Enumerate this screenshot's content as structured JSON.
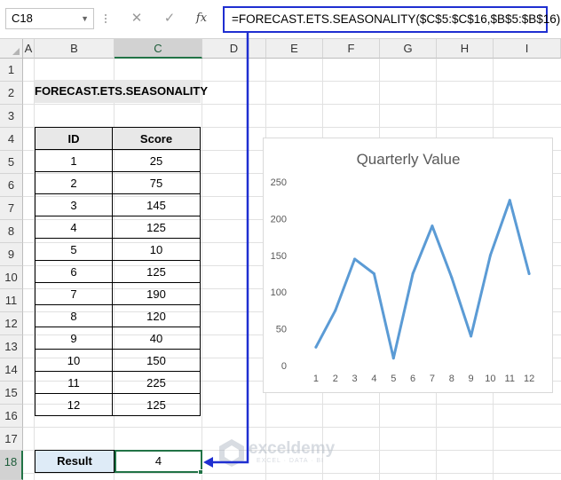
{
  "name_box": "C18",
  "formula_bar": {
    "cancel_icon": "✕",
    "enter_icon": "✓",
    "fx_label": "fx",
    "formula": "=FORECAST.ETS.SEASONALITY($C$5:$C$16,$B$5:$B$16)"
  },
  "columns": [
    "A",
    "B",
    "C",
    "D",
    "E",
    "F",
    "G",
    "H",
    "I"
  ],
  "rows": [
    "1",
    "2",
    "3",
    "4",
    "5",
    "6",
    "7",
    "8",
    "9",
    "10",
    "11",
    "12",
    "13",
    "14",
    "15",
    "16",
    "17",
    "18"
  ],
  "title_cell": "FORECAST.ETS.SEASONALITY",
  "table": {
    "headers": [
      "ID",
      "Score"
    ],
    "rows": [
      [
        "1",
        "25"
      ],
      [
        "2",
        "75"
      ],
      [
        "3",
        "145"
      ],
      [
        "4",
        "125"
      ],
      [
        "5",
        "10"
      ],
      [
        "6",
        "125"
      ],
      [
        "7",
        "190"
      ],
      [
        "8",
        "120"
      ],
      [
        "9",
        "40"
      ],
      [
        "10",
        "150"
      ],
      [
        "11",
        "225"
      ],
      [
        "12",
        "125"
      ]
    ]
  },
  "result": {
    "label": "Result",
    "value": "4"
  },
  "watermark": {
    "name": "exceldemy",
    "tagline": "EXCEL · DATA · BI"
  },
  "colors": {
    "line": "#5b9bd5",
    "arrow": "#1f2fd1",
    "selection": "#217346"
  },
  "chart_data": {
    "type": "line",
    "title": "Quarterly Value",
    "categories": [
      "1",
      "2",
      "3",
      "4",
      "5",
      "6",
      "7",
      "8",
      "9",
      "10",
      "11",
      "12"
    ],
    "series": [
      {
        "values": [
          25,
          75,
          145,
          125,
          10,
          125,
          190,
          120,
          40,
          150,
          225,
          125
        ]
      }
    ],
    "ylim": [
      0,
      250
    ],
    "yticks": [
      "0",
      "50",
      "100",
      "150",
      "200",
      "250"
    ],
    "grid": false,
    "legend": "none"
  }
}
